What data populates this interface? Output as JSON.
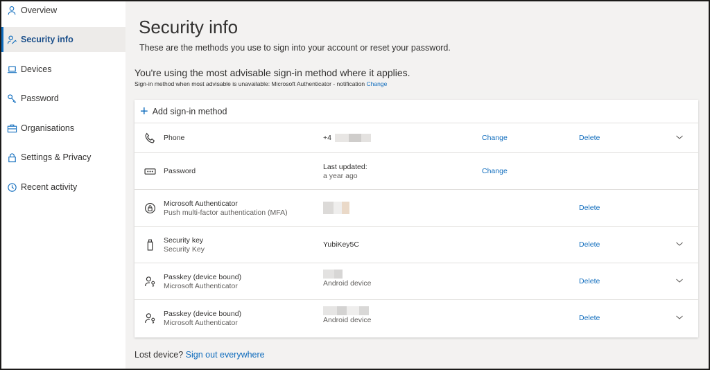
{
  "sidebar": {
    "items": [
      {
        "label": "Overview",
        "icon": "person-icon"
      },
      {
        "label": "Security info",
        "icon": "person-key-icon"
      },
      {
        "label": "Devices",
        "icon": "laptop-icon"
      },
      {
        "label": "Password",
        "icon": "key-icon"
      },
      {
        "label": "Organisations",
        "icon": "briefcase-icon"
      },
      {
        "label": "Settings & Privacy",
        "icon": "lock-icon"
      },
      {
        "label": "Recent activity",
        "icon": "history-icon"
      }
    ],
    "active_index": 1
  },
  "main": {
    "title": "Security info",
    "subtitle": "These are the methods you use to sign into your account or reset your password.",
    "advisable_title": "You're using the most advisable sign-in method where it applies.",
    "advisable_sub": "Sign-in method when most advisable is unavailable: Microsoft Authenticator - notification",
    "advisable_change": "Change",
    "add_method": "Add sign-in method",
    "methods": [
      {
        "name": "Phone",
        "sub": "",
        "detail": "+4",
        "detail_sub": "",
        "change": "Change",
        "delete": "Delete",
        "icon": "phone-icon"
      },
      {
        "name": "Password",
        "sub": "",
        "detail": "Last updated:",
        "detail_sub": "a year ago",
        "change": "Change",
        "delete": "",
        "icon": "password-dots-icon"
      },
      {
        "name": "Microsoft Authenticator",
        "sub": "Push multi-factor authentication (MFA)",
        "detail": "",
        "detail_sub": "",
        "change": "",
        "delete": "Delete",
        "icon": "authenticator-lock-icon"
      },
      {
        "name": "Security key",
        "sub": "Security Key",
        "detail": "YubiKey5C",
        "detail_sub": "",
        "change": "",
        "delete": "Delete",
        "icon": "usb-key-icon"
      },
      {
        "name": "Passkey (device bound)",
        "sub": "Microsoft Authenticator",
        "detail": "",
        "detail_sub": "Android device",
        "change": "",
        "delete": "Delete",
        "icon": "passkey-icon"
      },
      {
        "name": "Passkey (device bound)",
        "sub": "Microsoft Authenticator",
        "detail": "",
        "detail_sub": "Android device",
        "change": "",
        "delete": "Delete",
        "icon": "passkey-icon"
      }
    ],
    "lost_device": "Lost device?",
    "sign_out_everywhere": "Sign out everywhere"
  },
  "colors": {
    "accent": "#0f6cbd",
    "active_bg": "#edebe9",
    "page_bg": "#f3f2f1"
  }
}
